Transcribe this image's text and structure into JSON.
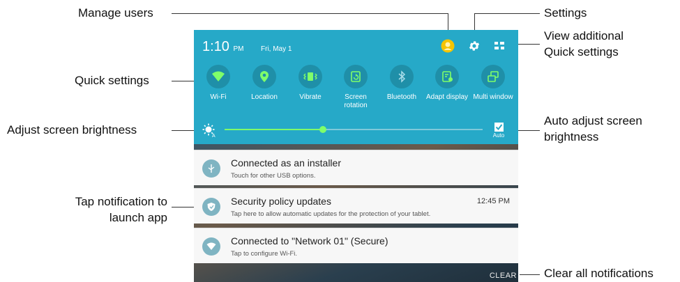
{
  "callouts": {
    "manage_users": "Manage users",
    "settings": "Settings",
    "view_additional_line1": "View additional",
    "view_additional_line2": "Quick settings",
    "quick_settings": "Quick settings",
    "adjust_brightness": "Adjust screen brightness",
    "auto_adjust_line1": "Auto adjust screen",
    "auto_adjust_line2": "brightness",
    "tap_notif_line1": "Tap notification to",
    "tap_notif_line2": "launch app",
    "clear_all": "Clear all notifications"
  },
  "status": {
    "time": "1:10",
    "ampm": "PM",
    "date": "Fri, May 1"
  },
  "top_icons": {
    "manage_users": "user-avatar-icon",
    "settings": "gear-icon",
    "view_additional": "grid-icon"
  },
  "quick_tiles": [
    {
      "label": "Wi-Fi",
      "icon": "wifi-icon"
    },
    {
      "label": "Location",
      "icon": "location-icon"
    },
    {
      "label": "Vibrate",
      "icon": "vibrate-icon"
    },
    {
      "label": "Screen rotation",
      "icon": "screen-rotation-icon"
    },
    {
      "label": "Bluetooth",
      "icon": "bluetooth-icon"
    },
    {
      "label": "Adapt display",
      "icon": "adapt-display-icon"
    },
    {
      "label": "Multi window",
      "icon": "multi-window-icon"
    }
  ],
  "brightness": {
    "level": 0.38,
    "auto_label": "Auto",
    "auto_checked": true
  },
  "notifications": [
    {
      "title": "Connected as an installer",
      "subtitle": "Touch for other USB options.",
      "time": "",
      "icon": "usb-icon"
    },
    {
      "title": "Security policy updates",
      "subtitle": "Tap here to allow automatic updates for the protection of your tablet.",
      "time": "12:45 PM",
      "icon": "shield-icon"
    },
    {
      "title": "Connected to \"Network 01\" (Secure)",
      "subtitle": "Tap to configure Wi-Fi.",
      "time": "",
      "icon": "wifi-icon"
    }
  ],
  "clear_label": "CLEAR",
  "colors": {
    "quick_panel": "#26a9c8",
    "tile_circle": "#1f8fa8",
    "slider_active": "#7fff6a",
    "avatar": "#f5c400"
  }
}
